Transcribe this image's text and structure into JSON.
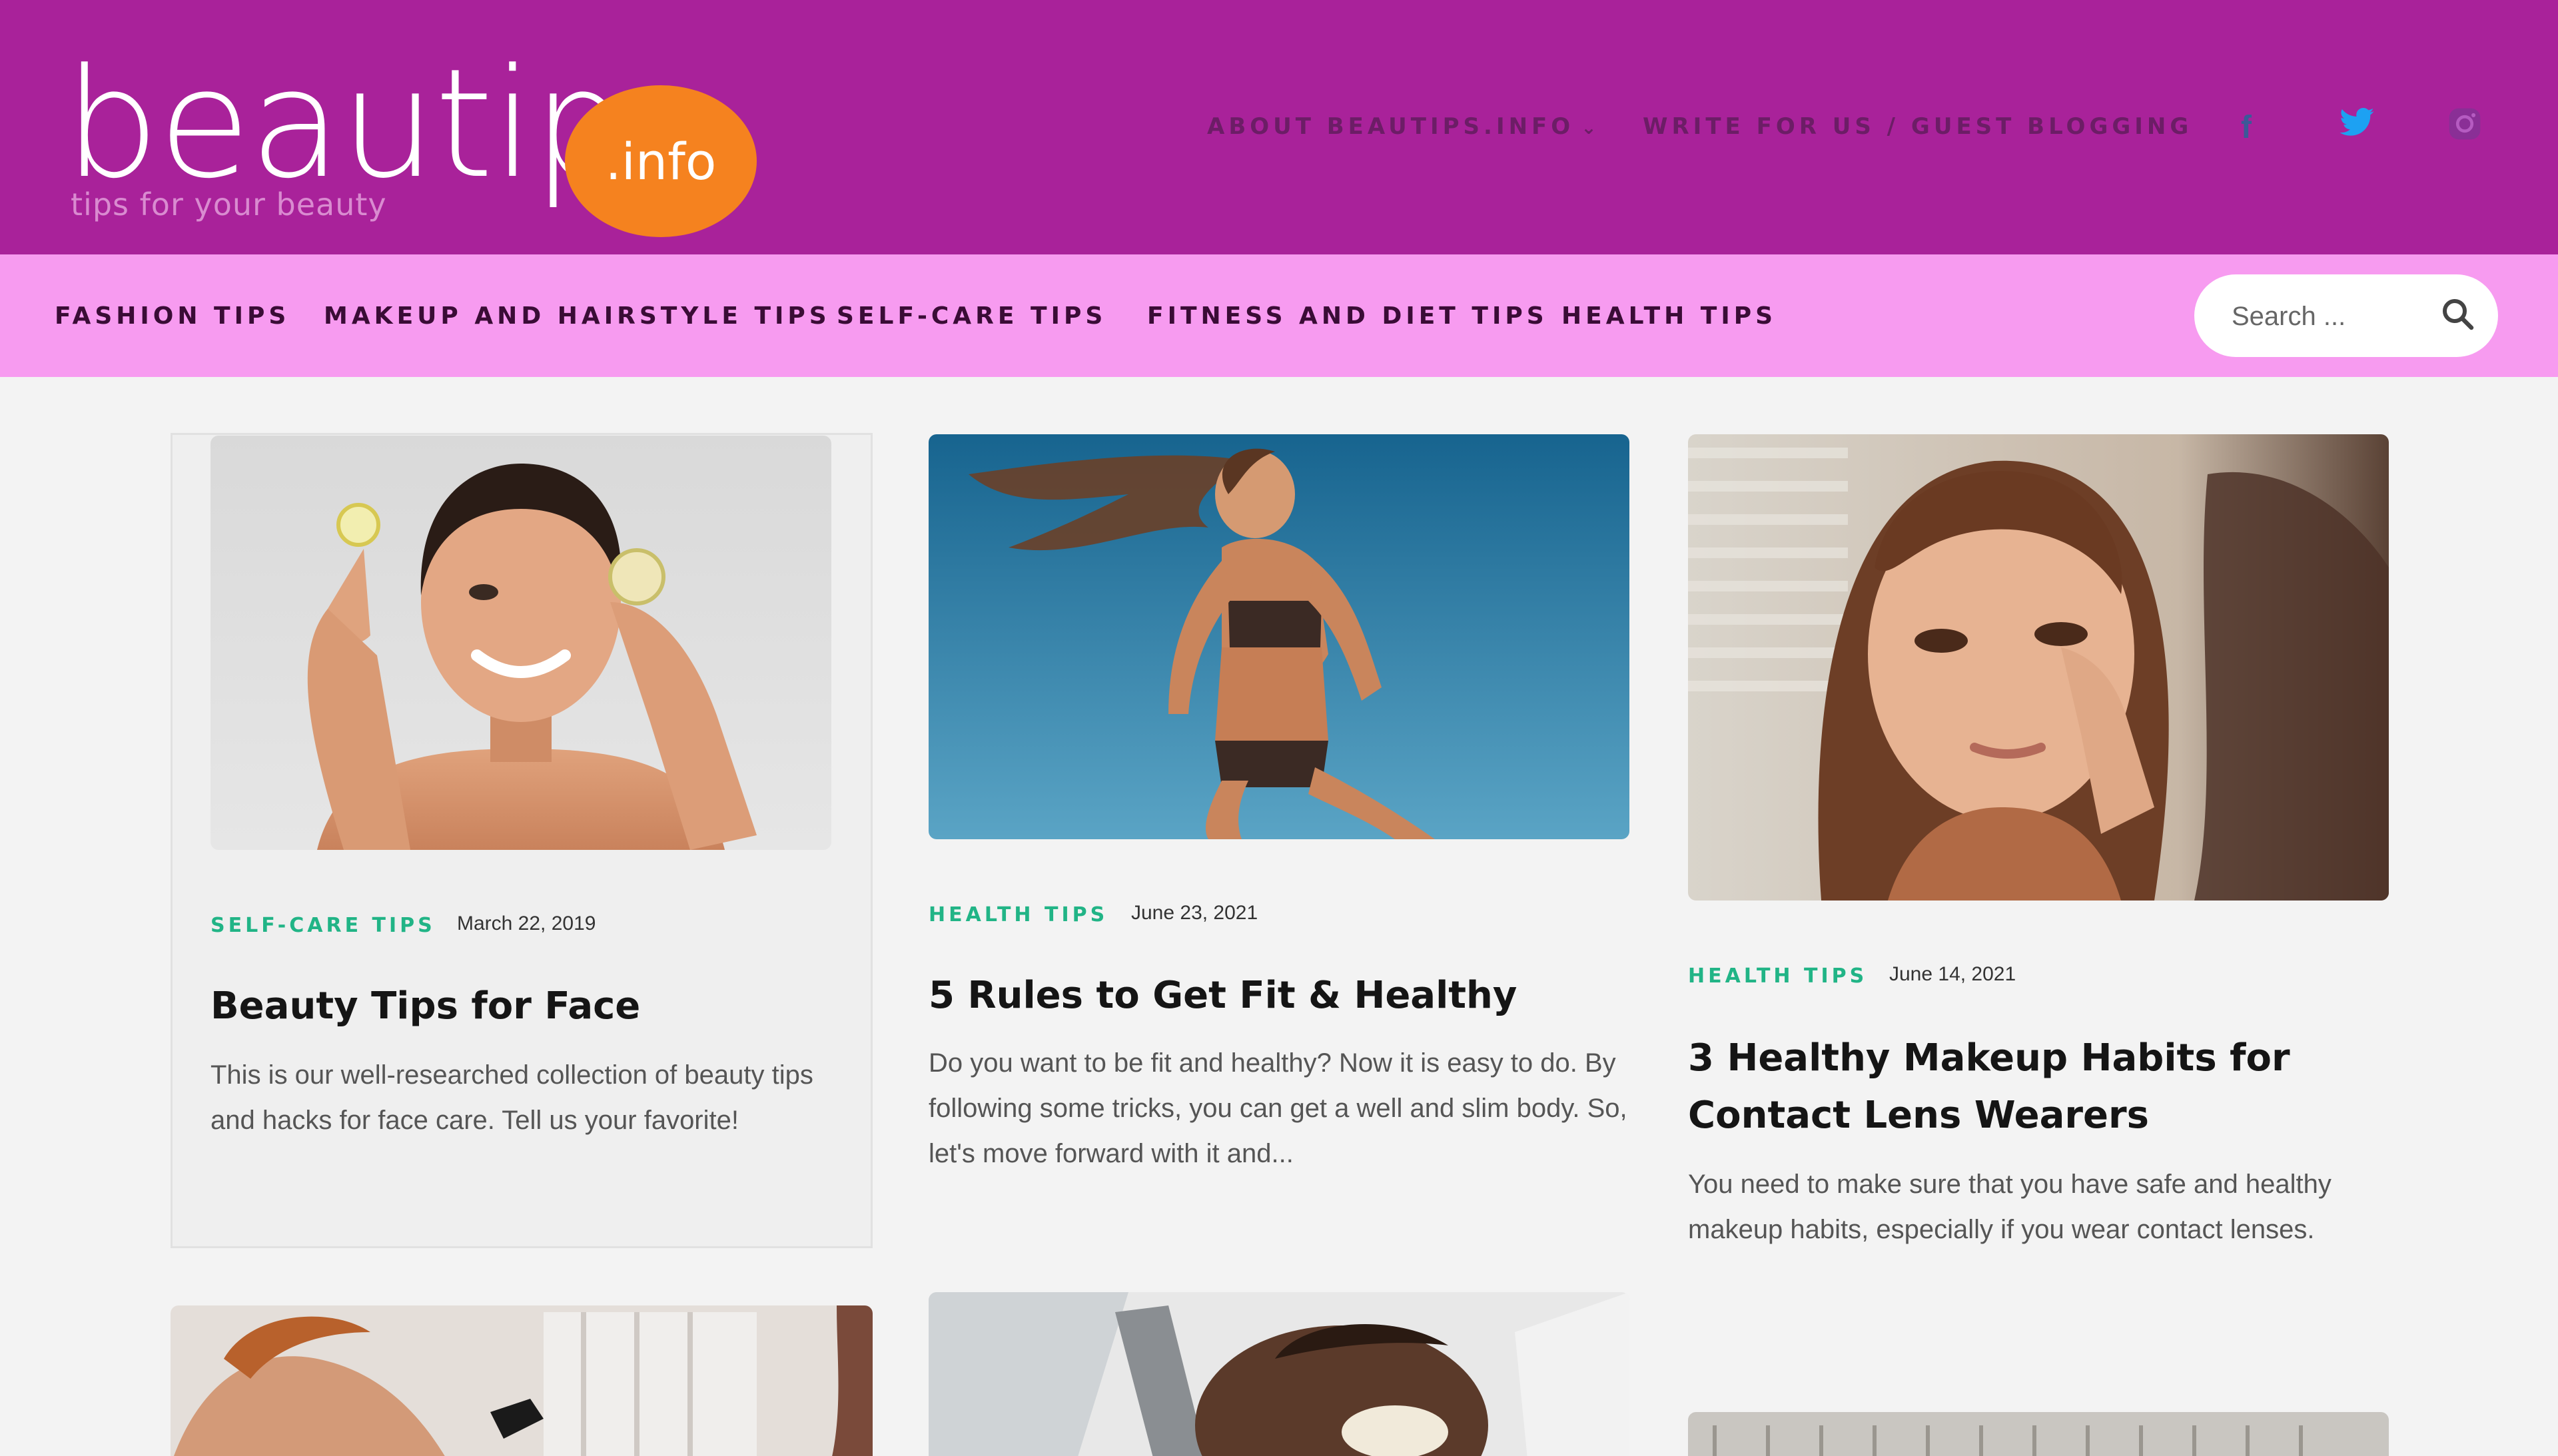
{
  "header": {
    "logo_word": "beautips",
    "logo_badge": ".info",
    "tagline": "tips for your beauty",
    "nav": [
      {
        "label": "ABOUT BEAUTIPS.INFO",
        "chevron": "⌄"
      },
      {
        "label": "WRITE FOR US / GUEST BLOGGING"
      }
    ],
    "social": [
      {
        "icon": "facebook-icon",
        "glyph": "f"
      },
      {
        "icon": "twitter-icon",
        "glyph": "🐦"
      },
      {
        "icon": "instagram-icon",
        "glyph": "◎"
      }
    ]
  },
  "categories": [
    "FASHION TIPS",
    "MAKEUP AND HAIRSTYLE TIPS",
    "SELF-CARE TIPS",
    "FITNESS AND DIET TIPS",
    "HEALTH TIPS"
  ],
  "search": {
    "placeholder": "Search ..."
  },
  "posts": [
    {
      "category": "SELF-CARE TIPS",
      "date": "March 22, 2019",
      "title": "Beauty Tips for Face",
      "excerpt": "This is our well-researched collection of beauty tips and hacks for face care. Tell us your favorite!"
    },
    {
      "category": "HEALTH TIPS",
      "date": "June 23, 2021",
      "title": "5 Rules to Get Fit & Healthy",
      "excerpt": "Do you want to be fit and healthy? Now it is easy to do. By following some tricks, you can get a well and slim body. So, let's move forward with it and..."
    },
    {
      "category": "HEALTH TIPS",
      "date": "June 14, 2021",
      "title": "3 Healthy Makeup Habits for Contact Lens Wearers",
      "excerpt": "You need to make sure that you have safe and healthy makeup habits, especially if you wear contact lenses."
    }
  ],
  "colors": {
    "header_bg": "#a9229a",
    "category_bar_bg": "#f79bf0",
    "badge_orange": "#f5821f",
    "category_green": "#21b486"
  }
}
